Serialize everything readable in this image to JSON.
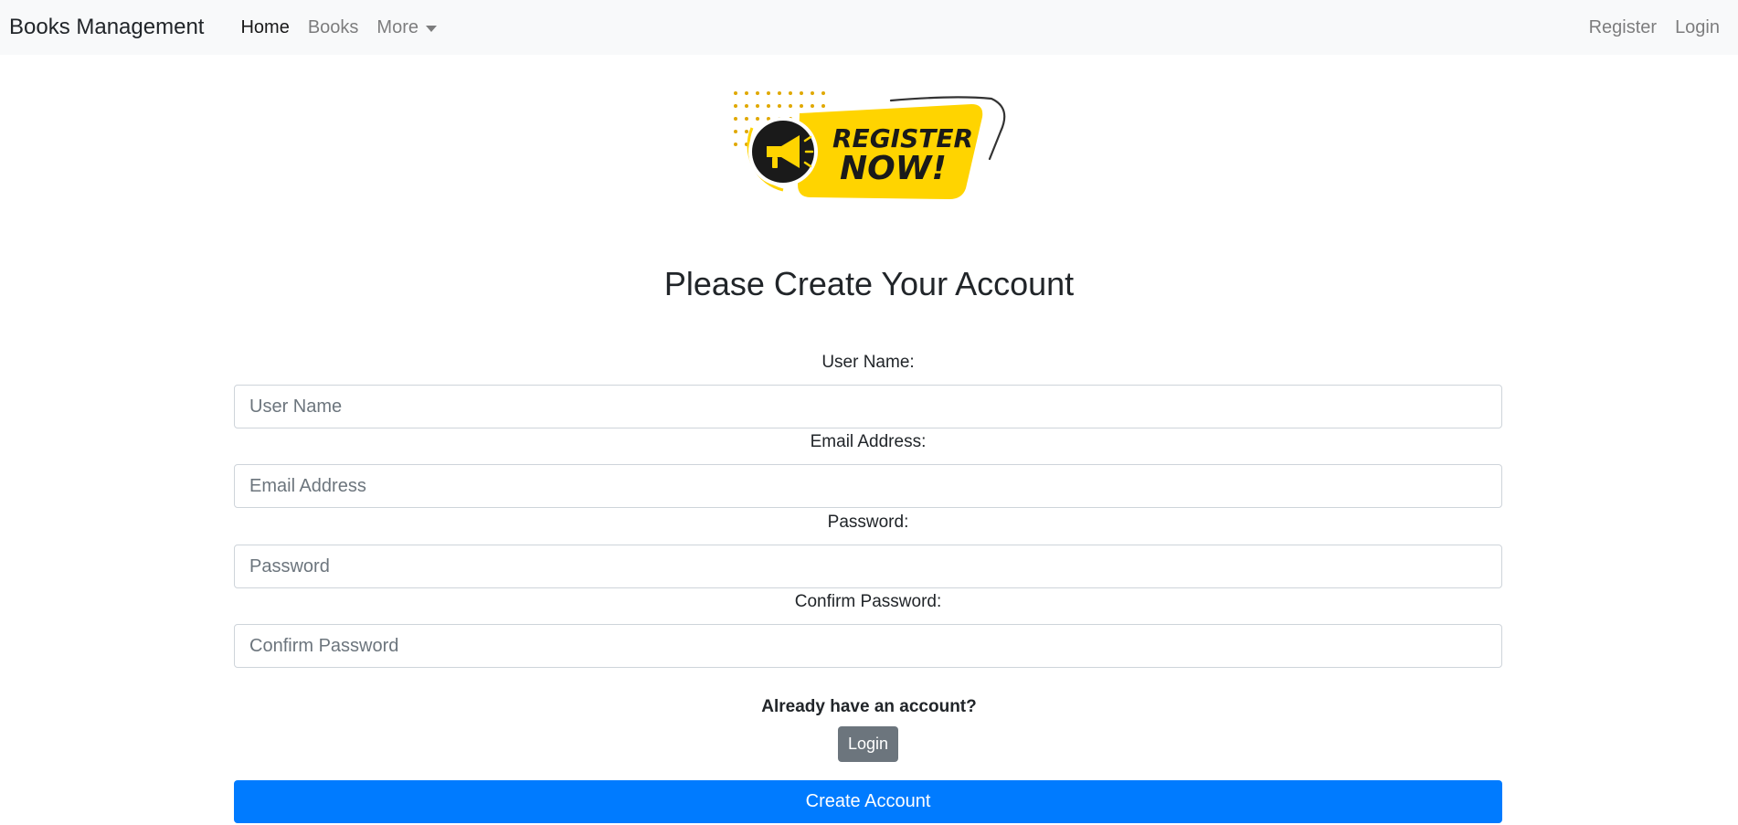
{
  "navbar": {
    "brand": "Books Management",
    "left_links": [
      {
        "label": "Home"
      },
      {
        "label": "Books"
      },
      {
        "label": "More"
      }
    ],
    "right_links": [
      {
        "label": "Register"
      },
      {
        "label": "Login"
      }
    ]
  },
  "banner": {
    "line1": "REGISTER",
    "line2": "NOW!",
    "icon": "megaphone-icon"
  },
  "form": {
    "title": "Please Create Your Account",
    "fields": [
      {
        "label": "User Name:",
        "placeholder": "User Name",
        "value": ""
      },
      {
        "label": "Email Address:",
        "placeholder": "Email Address",
        "value": ""
      },
      {
        "label": "Password:",
        "placeholder": "Password",
        "value": ""
      },
      {
        "label": "Confirm Password:",
        "placeholder": "Confirm Password",
        "value": ""
      }
    ],
    "already_text": "Already have an account?",
    "login_label": "Login",
    "submit_label": "Create Account"
  },
  "colors": {
    "primary": "#007bff",
    "secondary": "#6c757d",
    "navbar_bg": "#f8f9fa",
    "banner_yellow": "#ffd400",
    "banner_dark": "#1a1a1a"
  }
}
